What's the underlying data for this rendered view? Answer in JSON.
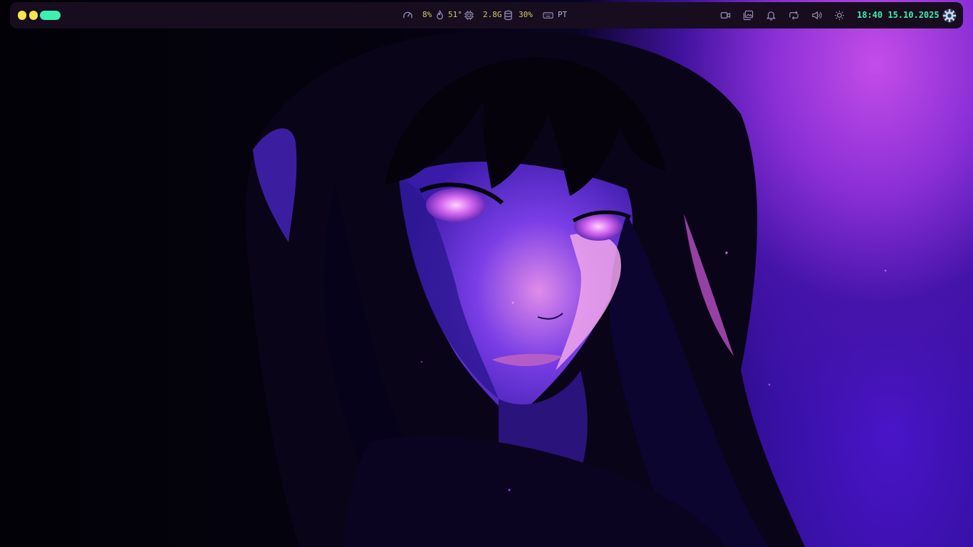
{
  "desktop": {
    "wallpaper": "anime-girl-purple-wallpaper"
  },
  "topbar": {
    "workspaces": [
      {
        "id": "1",
        "color": "#f6e54b",
        "active": false
      },
      {
        "id": "2",
        "color": "#f6e54b",
        "active": false
      },
      {
        "id": "3",
        "color": "#3ef0b0",
        "active": true
      }
    ],
    "cpu": {
      "icon": "speedometer-icon",
      "value": "8%"
    },
    "temperature": {
      "icon": "flame-icon",
      "value": "51°"
    },
    "memory": {
      "icon": "chip-icon",
      "value": "2.8G"
    },
    "disk": {
      "icon": "database-icon",
      "value": "30%"
    },
    "keyboard": {
      "icon": "keyboard-icon",
      "layout": "PT"
    },
    "tray_icons": [
      "video-camera-icon",
      "gallery-icon",
      "bell-icon",
      "repeat-icon",
      "volume-icon",
      "brightness-icon"
    ],
    "clock": "18:40 15.10.2025",
    "launcher": {
      "icon": "gear-icon"
    }
  },
  "colors": {
    "bar_bg": "#170d1f",
    "accent_green": "#3ef0b0",
    "accent_yellow": "#f6e54b",
    "stat_text": "#d6c86b",
    "icon": "#9a8fb8"
  }
}
